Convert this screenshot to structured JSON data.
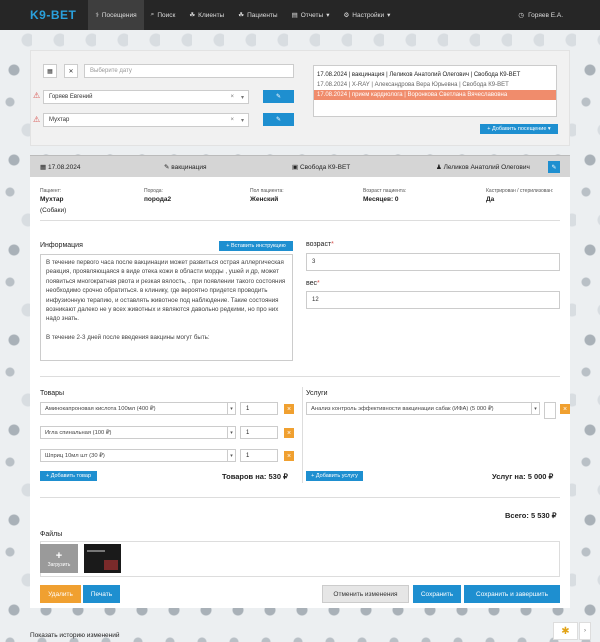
{
  "nav": {
    "logo": "K9-BET",
    "items": [
      "Посещения",
      "Поиск",
      "Клиенты",
      "Пациенты",
      "Отчеты",
      "Настройки"
    ],
    "user": "Горяев Е.А."
  },
  "top": {
    "date_placeholder": "Выберите дату",
    "doctor": "Горяев Евгений",
    "patient": "Мухтар",
    "visits": [
      "17.08.2024 | вакцинация | Леликов Анатолий Олегович | Свобода К9-ВЕТ",
      "17.08.2024 | X-RAY | Александрова Вера Юрьевна | Свобода К9-ВЕТ",
      "17.08.2024 | прием кардиолога | Воронкова Светлана Вячеславовна"
    ],
    "add_visit": "Добавить посещение"
  },
  "header": {
    "date": "17.08.2024",
    "type": "вакцинация",
    "clinic": "Свобода К9-ВЕТ",
    "doctor": "Леликов Анатолий Олегович"
  },
  "patient": {
    "name_label": "Пациент:",
    "name": "Мухтар",
    "species": "(Собаки)",
    "breed_label": "Порода:",
    "breed": "порода2",
    "sex_label": "Пол пациента:",
    "sex": "Женский",
    "age_label": "Возраст пациента:",
    "age": "Месяцев: 0",
    "castr_label": "Кастрирован / стерилизован:",
    "castr": "Да"
  },
  "info": {
    "label": "Информация",
    "insert_btn": "Вставить инструкцию",
    "p1": "В течение первого часа после вакцинации может развиться острая аллергическая реакция, проявляющаяся в виде отека кожи в области морды , ушей и др, может появиться многократная рвота и резкая вялость, . при появлении такого состояния необходимо срочно обратиться. в клинику, где вероятно придется проводить инфузионную терапию, и оставлять животное под наблюдение. Такие состояния возникают далеко не у всех животных и являются давольно редкими, но про них надо знать.",
    "p2": "В течение 2-3 дней после введения вакцины могут быть:"
  },
  "age_field": {
    "label": "возраст",
    "value": "3"
  },
  "weight_field": {
    "label": "вес",
    "value": "12"
  },
  "goods": {
    "label": "Товары",
    "items": [
      {
        "name": "Аминокапроновая кислота 100мл (400 ₽)",
        "qty": "1"
      },
      {
        "name": "Игла спинальная (100 ₽)",
        "qty": "1"
      },
      {
        "name": "Шприц 10мл шт (30 ₽)",
        "qty": "1"
      }
    ],
    "add": "Добавить товар",
    "total": "Товаров на: 530 ₽"
  },
  "services": {
    "label": "Услуги",
    "items": [
      {
        "name": "Анализ контроль эффективности вакцинации сабак (ИФА) (5 000 ₽)"
      }
    ],
    "add": "Добавить услугу",
    "total": "Услуг на: 5 000 ₽"
  },
  "sum": "Всего: 5 530 ₽",
  "files": {
    "label": "Файлы",
    "upload": "Загрузить"
  },
  "actions": {
    "delete": "Удалить",
    "print": "Печать",
    "cancel": "Отменить изменения",
    "save": "Сохранить",
    "save_finish": "Сохранить и завершить"
  },
  "history": "Показать историю изменений",
  "colors": {
    "primary": "#1e8fd0",
    "orange": "#f0a030",
    "selected_visit": "#f08c6c",
    "navbar": "#262626"
  }
}
